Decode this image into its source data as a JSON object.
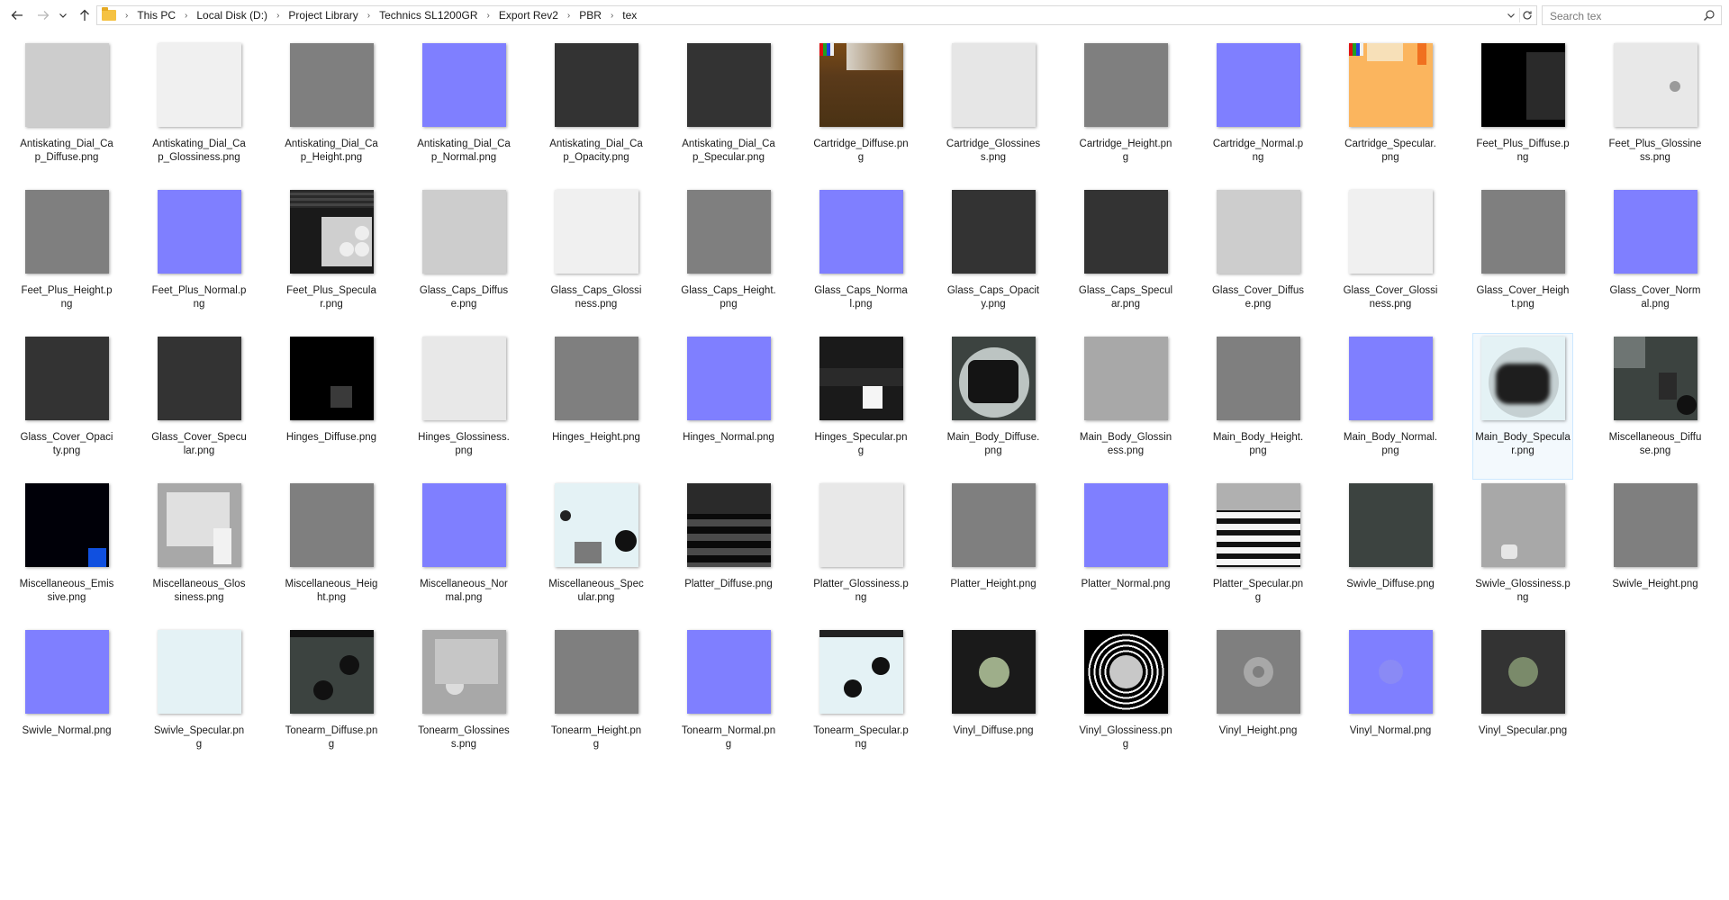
{
  "nav": {
    "back_icon": "arrow-left-icon",
    "forward_icon": "arrow-right-icon",
    "recent_icon": "chevron-down-icon",
    "up_icon": "arrow-up-icon"
  },
  "breadcrumbs": [
    "This PC",
    "Local Disk (D:)",
    "Project Library",
    "Technics SL1200GR",
    "Export Rev2",
    "PBR",
    "tex"
  ],
  "search": {
    "placeholder": "Search tex",
    "value": ""
  },
  "colors": {
    "normal_map": "#7f7fff",
    "selection": "#cce8ff"
  },
  "files": [
    {
      "name": "Antiskating_Dial_Cap_Diffuse.png",
      "color": "#cdcdcd",
      "pattern": "solid"
    },
    {
      "name": "Antiskating_Dial_Cap_Glossiness.png",
      "color": "#f0f0f0",
      "pattern": "solid"
    },
    {
      "name": "Antiskating_Dial_Cap_Height.png",
      "color": "#7f7f7f",
      "pattern": "solid"
    },
    {
      "name": "Antiskating_Dial_Cap_Normal.png",
      "color": "#7f7fff",
      "pattern": "solid"
    },
    {
      "name": "Antiskating_Dial_Cap_Opacity.png",
      "color": "#333333",
      "pattern": "solid"
    },
    {
      "name": "Antiskating_Dial_Cap_Specular.png",
      "color": "#333333",
      "pattern": "solid"
    },
    {
      "name": "Cartridge_Diffuse.png",
      "color": "#5a3a1a",
      "pattern": "cartridge"
    },
    {
      "name": "Cartridge_Glossiness.png",
      "color": "#e6e6e6",
      "pattern": "solid"
    },
    {
      "name": "Cartridge_Height.png",
      "color": "#7f7f7f",
      "pattern": "solid"
    },
    {
      "name": "Cartridge_Normal.png",
      "color": "#7f7fff",
      "pattern": "solid"
    },
    {
      "name": "Cartridge_Specular.png",
      "color": "#fbb55e",
      "pattern": "cartspec"
    },
    {
      "name": "Feet_Plus_Diffuse.png",
      "color": "#000000",
      "pattern": "feetdiff"
    },
    {
      "name": "Feet_Plus_Glossiness.png",
      "color": "#e8e8e8",
      "pattern": "dot"
    },
    {
      "name": "Feet_Plus_Height.png",
      "color": "#7f7f7f",
      "pattern": "solid"
    },
    {
      "name": "Feet_Plus_Normal.png",
      "color": "#7f7fff",
      "pattern": "solid"
    },
    {
      "name": "Feet_Plus_Specular.png",
      "color": "#1a1a1a",
      "pattern": "feetspec"
    },
    {
      "name": "Glass_Caps_Diffuse.png",
      "color": "#cdcdcd",
      "pattern": "solid"
    },
    {
      "name": "Glass_Caps_Glossiness.png",
      "color": "#f0f0f0",
      "pattern": "solid"
    },
    {
      "name": "Glass_Caps_Height.png",
      "color": "#7f7f7f",
      "pattern": "solid"
    },
    {
      "name": "Glass_Caps_Normal.png",
      "color": "#7f7fff",
      "pattern": "solid"
    },
    {
      "name": "Glass_Caps_Opacity.png",
      "color": "#333333",
      "pattern": "solid"
    },
    {
      "name": "Glass_Caps_Specular.png",
      "color": "#333333",
      "pattern": "solid"
    },
    {
      "name": "Glass_Cover_Diffuse.png",
      "color": "#cdcdcd",
      "pattern": "solid"
    },
    {
      "name": "Glass_Cover_Glossiness.png",
      "color": "#f0f0f0",
      "pattern": "solid"
    },
    {
      "name": "Glass_Cover_Height.png",
      "color": "#7f7f7f",
      "pattern": "solid"
    },
    {
      "name": "Glass_Cover_Normal.png",
      "color": "#7f7fff",
      "pattern": "solid"
    },
    {
      "name": "Glass_Cover_Opacity.png",
      "color": "#333333",
      "pattern": "solid"
    },
    {
      "name": "Glass_Cover_Specular.png",
      "color": "#333333",
      "pattern": "solid"
    },
    {
      "name": "Hinges_Diffuse.png",
      "color": "#000000",
      "pattern": "hingediff"
    },
    {
      "name": "Hinges_Glossiness.png",
      "color": "#e8e8e8",
      "pattern": "solid"
    },
    {
      "name": "Hinges_Height.png",
      "color": "#7f7f7f",
      "pattern": "solid"
    },
    {
      "name": "Hinges_Normal.png",
      "color": "#7f7fff",
      "pattern": "solid"
    },
    {
      "name": "Hinges_Specular.png",
      "color": "#1a1a1a",
      "pattern": "hingespec"
    },
    {
      "name": "Main_Body_Diffuse.png",
      "color": "#3c4340",
      "pattern": "bodydiff"
    },
    {
      "name": "Main_Body_Glossiness.png",
      "color": "#a8a8a8",
      "pattern": "solid"
    },
    {
      "name": "Main_Body_Height.png",
      "color": "#7f7f7f",
      "pattern": "solid"
    },
    {
      "name": "Main_Body_Normal.png",
      "color": "#7f7fff",
      "pattern": "solid"
    },
    {
      "name": "Main_Body_Specular.png",
      "color": "#e4f2f5",
      "pattern": "bodyspec",
      "selected": true
    },
    {
      "name": "Miscellaneous_Diffuse.png",
      "color": "#3c4340",
      "pattern": "miscdiff"
    },
    {
      "name": "Miscellaneous_Emissive.png",
      "color": "#000008",
      "pattern": "emissive"
    },
    {
      "name": "Miscellaneous_Glossiness.png",
      "color": "#a8a8a8",
      "pattern": "miscgloss"
    },
    {
      "name": "Miscellaneous_Height.png",
      "color": "#7f7f7f",
      "pattern": "solid"
    },
    {
      "name": "Miscellaneous_Normal.png",
      "color": "#7f7fff",
      "pattern": "solid"
    },
    {
      "name": "Miscellaneous_Specular.png",
      "color": "#e4f2f5",
      "pattern": "miscspec"
    },
    {
      "name": "Platter_Diffuse.png",
      "color": "#1a1a1a",
      "pattern": "platterdiff"
    },
    {
      "name": "Platter_Glossiness.png",
      "color": "#e8e8e8",
      "pattern": "solid"
    },
    {
      "name": "Platter_Height.png",
      "color": "#7f7f7f",
      "pattern": "solid"
    },
    {
      "name": "Platter_Normal.png",
      "color": "#7f7fff",
      "pattern": "solid"
    },
    {
      "name": "Platter_Specular.png",
      "color": "#f5f5f5",
      "pattern": "platterspec"
    },
    {
      "name": "Swivle_Diffuse.png",
      "color": "#3c4340",
      "pattern": "solid"
    },
    {
      "name": "Swivle_Glossiness.png",
      "color": "#a8a8a8",
      "pattern": "swivgloss"
    },
    {
      "name": "Swivle_Height.png",
      "color": "#7f7f7f",
      "pattern": "solid"
    },
    {
      "name": "Swivle_Normal.png",
      "color": "#7f7fff",
      "pattern": "solid"
    },
    {
      "name": "Swivle_Specular.png",
      "color": "#e4f2f5",
      "pattern": "solid"
    },
    {
      "name": "Tonearm_Diffuse.png",
      "color": "#3c4340",
      "pattern": "tonediff"
    },
    {
      "name": "Tonearm_Glossiness.png",
      "color": "#a8a8a8",
      "pattern": "tonegloss"
    },
    {
      "name": "Tonearm_Height.png",
      "color": "#7f7f7f",
      "pattern": "solid"
    },
    {
      "name": "Tonearm_Normal.png",
      "color": "#7f7fff",
      "pattern": "solid"
    },
    {
      "name": "Tonearm_Specular.png",
      "color": "#e4f2f5",
      "pattern": "tonespec"
    },
    {
      "name": "Vinyl_Diffuse.png",
      "color": "#1a1a1a",
      "pattern": "vinyldiff"
    },
    {
      "name": "Vinyl_Glossiness.png",
      "color": "#000000",
      "pattern": "vinylgloss"
    },
    {
      "name": "Vinyl_Height.png",
      "color": "#7f7f7f",
      "pattern": "vinylheight"
    },
    {
      "name": "Vinyl_Normal.png",
      "color": "#7f7fff",
      "pattern": "vinylnormal"
    },
    {
      "name": "Vinyl_Specular.png",
      "color": "#333333",
      "pattern": "vinylspec"
    }
  ]
}
